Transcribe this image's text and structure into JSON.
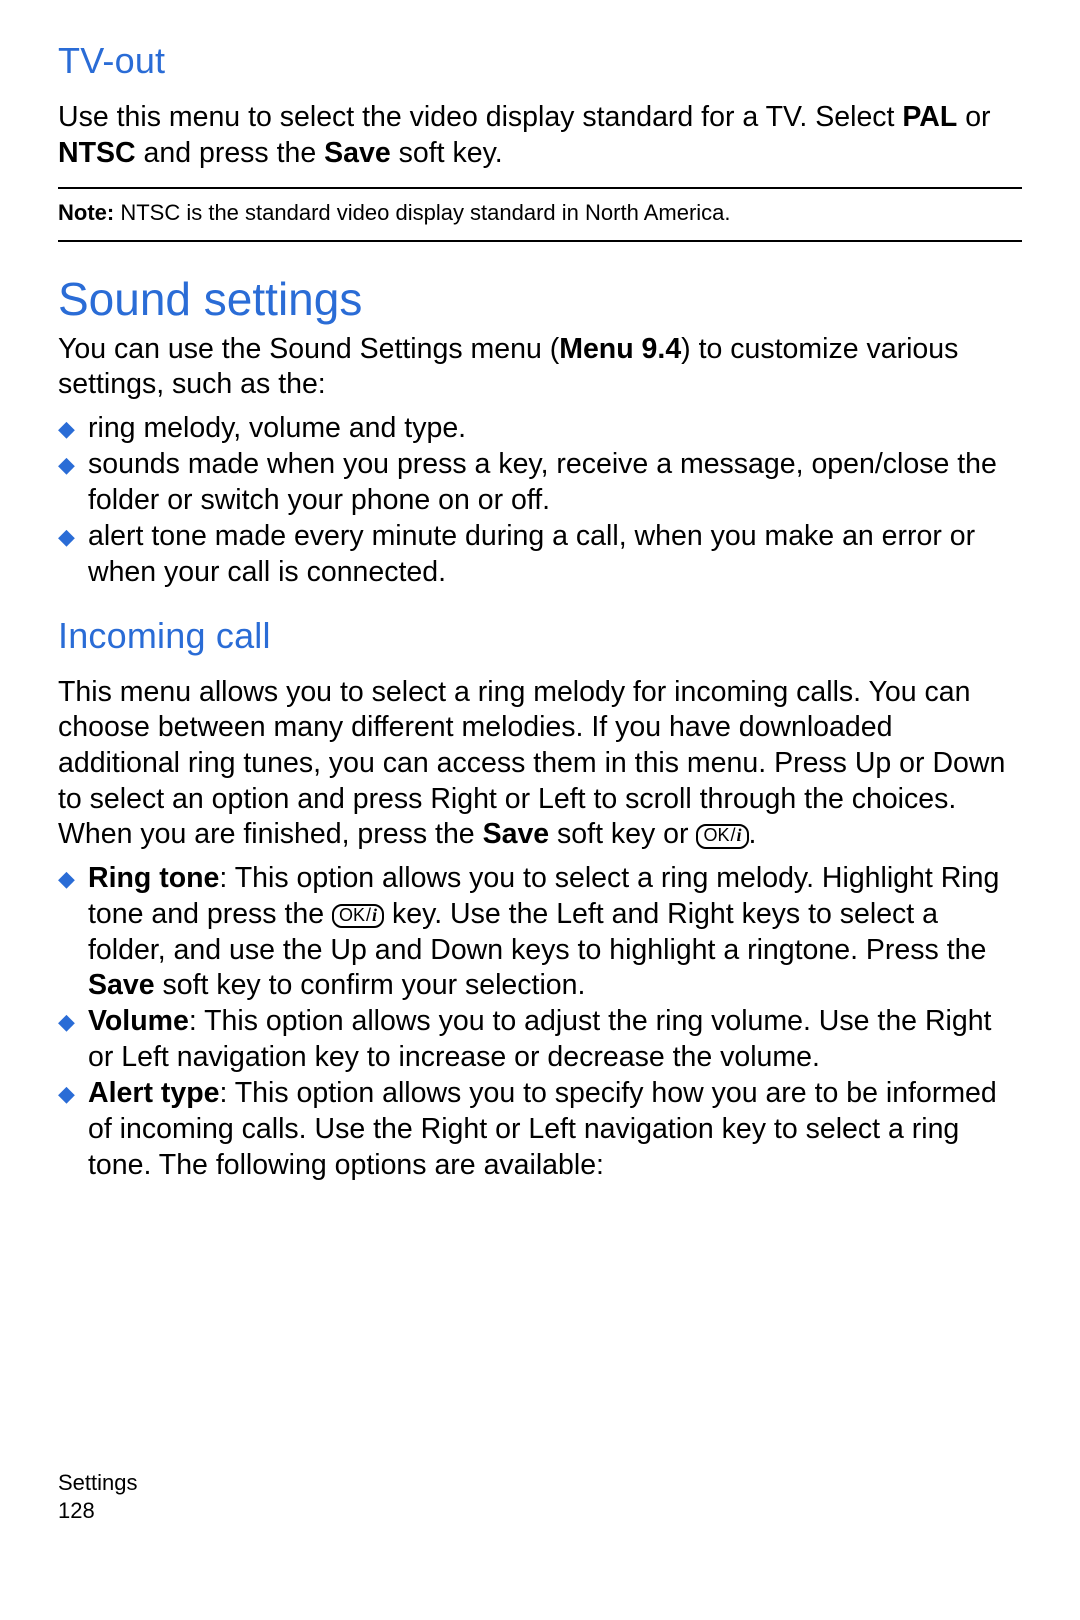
{
  "tvout": {
    "heading": "TV-out",
    "p_a": "Use this menu to select the video display standard for a TV. Select ",
    "pal": "PAL",
    "p_b": " or ",
    "ntsc": "NTSC",
    "p_c": " and press the ",
    "save": "Save",
    "p_d": " soft key.",
    "note_label": "Note:",
    "note_text": "  NTSC is the standard video display standard in North America."
  },
  "sound": {
    "heading": "Sound settings",
    "intro_a": "You can use the Sound Settings menu (",
    "intro_bold": "Menu 9.4",
    "intro_b": ") to customize various settings, such as the:",
    "bullets": [
      "ring melody, volume and type.",
      "sounds made when you press a key, receive a message, open/close the folder or switch your phone on or off.",
      "alert tone made every minute during a call, when you make an error or when your call is connected."
    ]
  },
  "incoming": {
    "heading": "Incoming call",
    "p1_a": "This menu allows you to select a ring melody for incoming calls. You can choose between many different melodies. If you have downloaded additional ring tunes, you can access them in this menu. Press Up or Down to select an option and press Right or Left to scroll through the choices. When you are finished, press the ",
    "p1_save": "Save",
    "p1_b": " soft key or ",
    "p1_c": ".",
    "b_ring_label": "Ring tone",
    "b_ring_a": ": This option allows you to select a ring melody. Highlight Ring tone and press the ",
    "b_ring_b": " key. Use the Left and Right keys to select a folder, and use the Up and Down keys to highlight a ringtone. Press the ",
    "b_ring_save": "Save",
    "b_ring_c": " soft key to confirm your selection.",
    "b_vol_label": "Volume",
    "b_vol_text": ": This option allows you to adjust the ring volume. Use the Right or Left navigation key to increase or decrease the volume.",
    "b_alert_label": "Alert type",
    "b_alert_text": ": This option allows you to specify how you are to be informed of incoming calls. Use the Right or Left navigation key to select a ring tone. The following options are available:"
  },
  "okkey": {
    "ok": "OK",
    "i": "i"
  },
  "footer": {
    "section": "Settings",
    "page": "128"
  }
}
